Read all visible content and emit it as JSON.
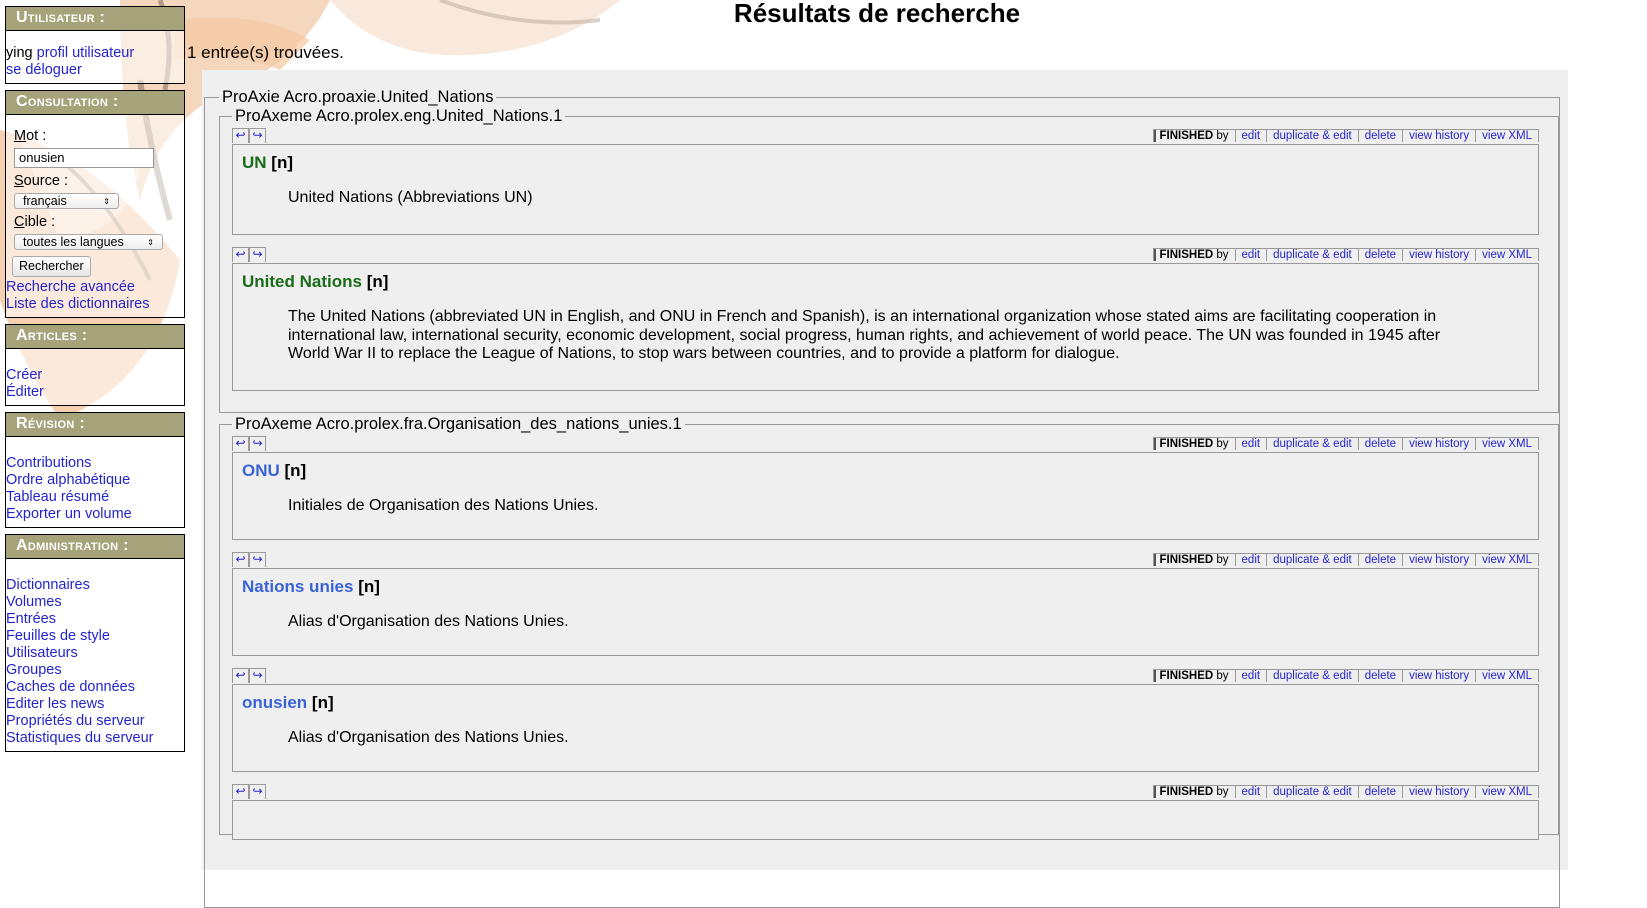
{
  "page": {
    "title": "Résultats de recherche",
    "count": "1 entrée(s) trouvées."
  },
  "sidebar": {
    "user": {
      "title": "Utilisateur :",
      "name": "ying",
      "profile_link": "profil utilisateur",
      "logout_link": "se déloguer"
    },
    "consultation": {
      "title": "Consultation :",
      "mot_label_first": "M",
      "mot_label_rest": "ot :",
      "mot_value": "onusien",
      "source_label_first": "S",
      "source_label_rest": "ource :",
      "source_value": "français",
      "cible_label_first": "C",
      "cible_label_rest": "ible :",
      "cible_value": "toutes les langues",
      "search_button": "Rechercher",
      "advanced_link": "Recherche avancée",
      "dictionaries_link": "Liste des dictionnaires"
    },
    "articles": {
      "title": "Articles :",
      "items": [
        "Créer",
        "Éditer"
      ]
    },
    "revision": {
      "title": "Révision :",
      "items": [
        "Contributions",
        "Ordre alphabétique",
        "Tableau résumé",
        "Exporter un volume"
      ]
    },
    "administration": {
      "title": "Administration :",
      "items": [
        "Dictionnaires",
        "Volumes",
        "Entrées",
        "Feuilles de style",
        "Utilisateurs",
        "Groupes",
        "Caches de données",
        "Editer les news",
        "Propriétés du serveur",
        "Statistiques du serveur"
      ]
    }
  },
  "actions": {
    "status": "FINISHED",
    "by": "by",
    "edit": "edit",
    "duplicate": "duplicate & edit",
    "delete": "delete",
    "history": "view history",
    "xml": "view XML"
  },
  "axie": {
    "legend": "ProAxie Acro.proaxie.United_Nations",
    "axemes": [
      {
        "legend": "ProAxeme Acro.prolex.eng.United_Nations.1",
        "entries": [
          {
            "headword": "UN",
            "pos": "[n]",
            "definition": "United Nations (Abbreviations UN)"
          },
          {
            "headword": "United Nations",
            "pos": "[n]",
            "definition": "The United Nations (abbreviated UN in English, and ONU in French and Spanish), is an international organization whose stated aims are facilitating cooperation in international law, international security, economic development, social progress, human rights, and achievement of world peace. The UN was founded in 1945 after World War II to replace the League of Nations, to stop wars between countries, and to provide a platform for dialogue."
          }
        ]
      },
      {
        "legend": "ProAxeme Acro.prolex.fra.Organisation_des_nations_unies.1",
        "entries": [
          {
            "headword": "ONU",
            "pos": "[n]",
            "definition": "Initiales de Organisation des Nations Unies."
          },
          {
            "headword": "Nations unies",
            "pos": "[n]",
            "definition": "Alias d'Organisation des Nations Unies."
          },
          {
            "headword": "onusien",
            "pos": "[n]",
            "definition": "Alias d'Organisation des Nations Unies."
          }
        ]
      }
    ]
  },
  "colors": {
    "sidebar_header": "#a6a279",
    "link": "#2424cc",
    "headword_eng": "#1a6b1a",
    "headword_fra": "#3a63d8",
    "panel_bg": "#efefef"
  }
}
